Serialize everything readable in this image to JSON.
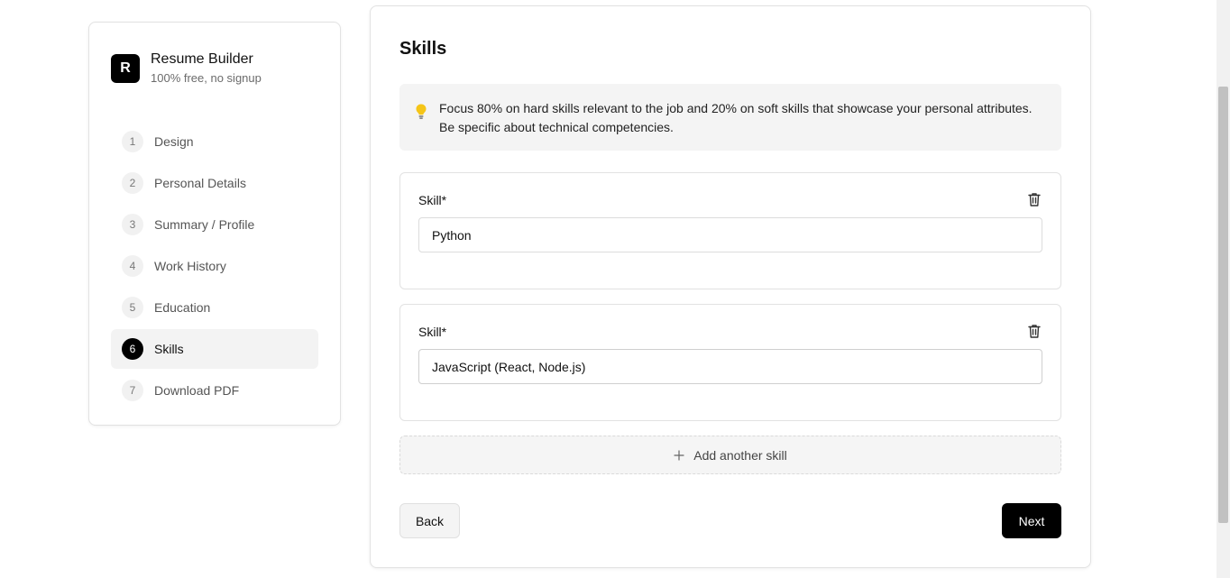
{
  "brand": {
    "logo_letter": "R",
    "title": "Resume Builder",
    "subtitle": "100% free, no signup"
  },
  "steps": [
    {
      "num": "1",
      "label": "Design"
    },
    {
      "num": "2",
      "label": "Personal Details"
    },
    {
      "num": "3",
      "label": "Summary / Profile"
    },
    {
      "num": "4",
      "label": "Work History"
    },
    {
      "num": "5",
      "label": "Education"
    },
    {
      "num": "6",
      "label": "Skills",
      "active": true
    },
    {
      "num": "7",
      "label": "Download PDF"
    }
  ],
  "main": {
    "title": "Skills",
    "tip": "Focus 80% on hard skills relevant to the job and 20% on soft skills that showcase your personal attributes. Be specific about technical competencies.",
    "skills": [
      {
        "label": "Skill*",
        "value": "Python"
      },
      {
        "label": "Skill*",
        "value": "JavaScript (React, Node.js)"
      }
    ],
    "add_label": "Add another skill",
    "back_label": "Back",
    "next_label": "Next"
  },
  "colors": {
    "accent": "#000000",
    "tip_bg": "#f4f4f4",
    "bulb": "#f5c518"
  },
  "icons": {
    "tip": "lightbulb-icon",
    "delete": "trash-icon",
    "add": "plus-icon"
  }
}
